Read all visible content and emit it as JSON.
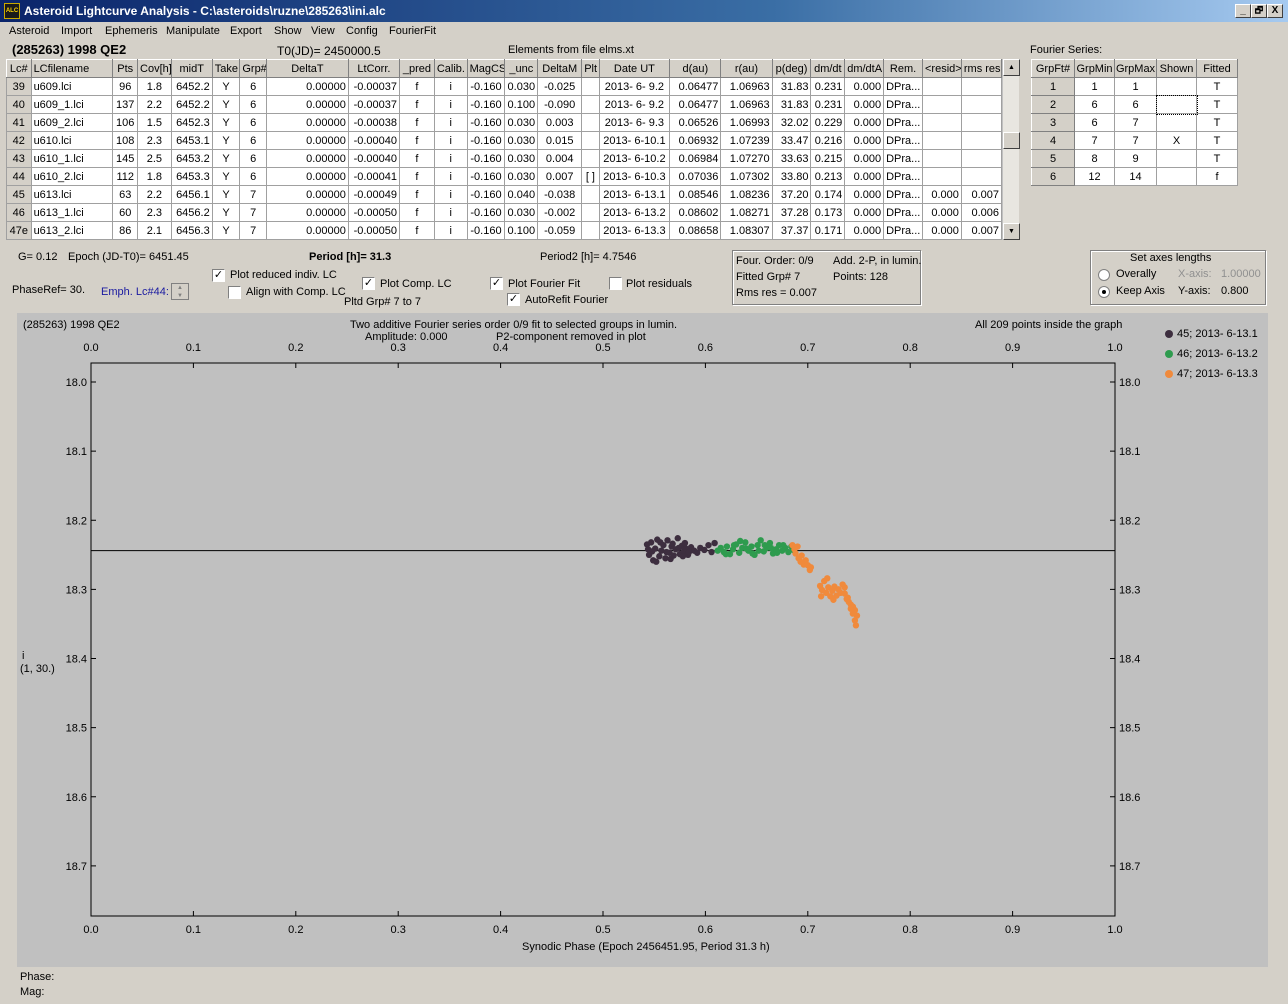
{
  "window": {
    "title": "Asteroid Lightcurve Analysis - C:\\asteroids\\ruzne\\285263\\ini.alc",
    "icon_label": "ALC",
    "controls": [
      "_",
      "🗗",
      "X"
    ]
  },
  "menu": [
    "Asteroid",
    "Import",
    "Ephemeris",
    "Manipulate",
    "Export",
    "Show",
    "View",
    "Config",
    "FourierFit"
  ],
  "header": {
    "asteroid": "(285263) 1998 QE2",
    "t0": "T0(JD)= 2450000.5",
    "elements": "Elements from file elms.xt"
  },
  "lc_table": {
    "columns": [
      "Lc#",
      "LCfilename",
      "Pts",
      "Cov[h]",
      "midT",
      "Take",
      "Grp#",
      "DeltaT",
      "LtCorr.",
      "_pred",
      "Calib.",
      "MagCS",
      "_unc",
      "DeltaM",
      "Plt",
      "Date UT",
      "d(au)",
      "r(au)",
      "p(deg)",
      "dm/dt",
      "dm/dtA",
      "Rem.",
      "<resid>",
      "rms res"
    ],
    "rows": [
      [
        "39",
        "u609.lci",
        "96",
        "1.8",
        "6452.2",
        "Y",
        "6",
        "0.00000",
        "-0.00037",
        "f",
        "i",
        "-0.160",
        "0.030",
        "-0.025",
        "",
        "2013- 6- 9.2",
        "0.06477",
        "1.06963",
        "31.83",
        "0.231",
        "0.000",
        "DPra...",
        "",
        ""
      ],
      [
        "40",
        "u609_1.lci",
        "137",
        "2.2",
        "6452.2",
        "Y",
        "6",
        "0.00000",
        "-0.00037",
        "f",
        "i",
        "-0.160",
        "0.100",
        "-0.090",
        "",
        "2013- 6- 9.2",
        "0.06477",
        "1.06963",
        "31.83",
        "0.231",
        "0.000",
        "DPra...",
        "",
        ""
      ],
      [
        "41",
        "u609_2.lci",
        "106",
        "1.5",
        "6452.3",
        "Y",
        "6",
        "0.00000",
        "-0.00038",
        "f",
        "i",
        "-0.160",
        "0.030",
        "0.003",
        "",
        "2013- 6- 9.3",
        "0.06526",
        "1.06993",
        "32.02",
        "0.229",
        "0.000",
        "DPra...",
        "",
        ""
      ],
      [
        "42",
        "u610.lci",
        "108",
        "2.3",
        "6453.1",
        "Y",
        "6",
        "0.00000",
        "-0.00040",
        "f",
        "i",
        "-0.160",
        "0.030",
        "0.015",
        "",
        "2013- 6-10.1",
        "0.06932",
        "1.07239",
        "33.47",
        "0.216",
        "0.000",
        "DPra...",
        "",
        ""
      ],
      [
        "43",
        "u610_1.lci",
        "145",
        "2.5",
        "6453.2",
        "Y",
        "6",
        "0.00000",
        "-0.00040",
        "f",
        "i",
        "-0.160",
        "0.030",
        "0.004",
        "",
        "2013- 6-10.2",
        "0.06984",
        "1.07270",
        "33.63",
        "0.215",
        "0.000",
        "DPra...",
        "",
        ""
      ],
      [
        "44",
        "u610_2.lci",
        "112",
        "1.8",
        "6453.3",
        "Y",
        "6",
        "0.00000",
        "-0.00041",
        "f",
        "i",
        "-0.160",
        "0.030",
        "0.007",
        "[ ]",
        "2013- 6-10.3",
        "0.07036",
        "1.07302",
        "33.80",
        "0.213",
        "0.000",
        "DPra...",
        "",
        ""
      ],
      [
        "45",
        "u613.lci",
        "63",
        "2.2",
        "6456.1",
        "Y",
        "7",
        "0.00000",
        "-0.00049",
        "f",
        "i",
        "-0.160",
        "0.040",
        "-0.038",
        "",
        "2013- 6-13.1",
        "0.08546",
        "1.08236",
        "37.20",
        "0.174",
        "0.000",
        "DPra...",
        "0.000",
        "0.007"
      ],
      [
        "46",
        "u613_1.lci",
        "60",
        "2.3",
        "6456.2",
        "Y",
        "7",
        "0.00000",
        "-0.00050",
        "f",
        "i",
        "-0.160",
        "0.030",
        "-0.002",
        "",
        "2013- 6-13.2",
        "0.08602",
        "1.08271",
        "37.28",
        "0.173",
        "0.000",
        "DPra...",
        "0.000",
        "0.006"
      ],
      [
        "47e",
        "u613_2.lci",
        "86",
        "2.1",
        "6456.3",
        "Y",
        "7",
        "0.00000",
        "-0.00050",
        "f",
        "i",
        "-0.160",
        "0.100",
        "-0.059",
        "",
        "2013- 6-13.3",
        "0.08658",
        "1.08307",
        "37.37",
        "0.171",
        "0.000",
        "DPra...",
        "0.000",
        "0.007"
      ]
    ]
  },
  "fourier_series": {
    "title": "Fourier Series:",
    "columns": [
      "GrpFt#",
      "GrpMin",
      "GrpMax",
      "Shown",
      "Fitted"
    ],
    "rows": [
      [
        "1",
        "1",
        "1",
        "",
        "T"
      ],
      [
        "2",
        "6",
        "6",
        "",
        "T"
      ],
      [
        "3",
        "6",
        "7",
        "",
        "T"
      ],
      [
        "4",
        "7",
        "7",
        "X",
        "T"
      ],
      [
        "5",
        "8",
        "9",
        "",
        "T"
      ],
      [
        "6",
        "12",
        "14",
        "",
        "f"
      ]
    ]
  },
  "controls": {
    "g": "G= 0.12",
    "epoch": "Epoch (JD-T0)= 6451.45",
    "period": "Period [h]= 31.3",
    "period2": "Period2 [h]= 4.7546",
    "phase_ref": "PhaseRef= 30.",
    "emph": "Emph. Lc#44:",
    "plot_reduced": "Plot reduced indiv. LC",
    "align": "Align with Comp. LC",
    "plot_comp": "Plot Comp. LC",
    "pltd_grp": "Pltd Grp#  7  to  7",
    "plot_fourier": "Plot Fourier Fit",
    "autorefit": "AutoRefit Fourier",
    "plot_residuals": "Plot residuals",
    "check_plot_reduced": "✓",
    "check_plot_comp": "✓",
    "check_plot_fourier": "✓",
    "check_autorefit": "✓"
  },
  "fit_info": {
    "order": "Four. Order:  0/9",
    "add": "Add. 2-P, in lumin.",
    "fitted": "Fitted Grp# 7",
    "points": "Points: 128",
    "rms": "Rms res     = 0.007"
  },
  "axes_box": {
    "title": "Set axes lengths",
    "overally": "Overally",
    "keep_axis": "Keep Axis",
    "x_label": "X-axis:",
    "x_value": "1.00000",
    "y_label": "Y-axis:",
    "y_value": "0.800"
  },
  "plot": {
    "title_left": "(285263) 1998 QE2",
    "title_center1": "Two additive Fourier series order 0/9 fit to selected groups in lumin.",
    "title_center2a": "Amplitude: 0.000",
    "title_center2b": "P2-component removed in plot",
    "title_right": "All 209 points inside the graph",
    "ylabel1": "i",
    "ylabel2": "(1, 30.)",
    "xlabel": "Synodic Phase (Epoch 2456451.95, Period 31.3 h)",
    "legend": [
      {
        "label": "45; 2013- 6-13.1",
        "color": "#3d2e3f"
      },
      {
        "label": "46; 2013- 6-13.2",
        "color": "#2e9b4e"
      },
      {
        "label": "47; 2013- 6-13.3",
        "color": "#f08a3c"
      }
    ]
  },
  "chart_data": {
    "type": "scatter",
    "xlim": [
      0.0,
      1.0
    ],
    "ylim": [
      18.7725,
      17.9725
    ],
    "x_ticks": [
      "0.0",
      "0.1",
      "0.2",
      "0.3",
      "0.4",
      "0.5",
      "0.6",
      "0.7",
      "0.8",
      "0.9",
      "1.0"
    ],
    "y_ticks": [
      "18.0",
      "18.1",
      "18.2",
      "18.3",
      "18.4",
      "18.5",
      "18.6",
      "18.7"
    ],
    "fit_line": 18.244,
    "series": [
      {
        "name": "45; 2013- 6-13.1",
        "color": "#3d2e3f",
        "points": [
          [
            0.543,
            18.235
          ],
          [
            0.545,
            18.25
          ],
          [
            0.547,
            18.232
          ],
          [
            0.549,
            18.258
          ],
          [
            0.551,
            18.241
          ],
          [
            0.553,
            18.228
          ],
          [
            0.555,
            18.252
          ],
          [
            0.557,
            18.244
          ],
          [
            0.559,
            18.236
          ],
          [
            0.561,
            18.255
          ],
          [
            0.563,
            18.229
          ],
          [
            0.565,
            18.247
          ],
          [
            0.567,
            18.238
          ],
          [
            0.569,
            18.251
          ],
          [
            0.571,
            18.242
          ],
          [
            0.573,
            18.226
          ],
          [
            0.575,
            18.249
          ],
          [
            0.577,
            18.237
          ],
          [
            0.579,
            18.245
          ],
          [
            0.581,
            18.241
          ],
          [
            0.583,
            18.25
          ],
          [
            0.586,
            18.239
          ],
          [
            0.589,
            18.244
          ],
          [
            0.592,
            18.247
          ],
          [
            0.595,
            18.24
          ],
          [
            0.599,
            18.243
          ],
          [
            0.603,
            18.236
          ],
          [
            0.606,
            18.246
          ],
          [
            0.609,
            18.233
          ],
          [
            0.548,
            18.245
          ],
          [
            0.556,
            18.232
          ],
          [
            0.562,
            18.246
          ],
          [
            0.568,
            18.234
          ],
          [
            0.574,
            18.24
          ],
          [
            0.58,
            18.233
          ],
          [
            0.584,
            18.246
          ],
          [
            0.552,
            18.26
          ],
          [
            0.566,
            18.256
          ],
          [
            0.578,
            18.252
          ],
          [
            0.544,
            18.242
          ]
        ]
      },
      {
        "name": "46; 2013- 6-13.2",
        "color": "#2e9b4e",
        "points": [
          [
            0.612,
            18.244
          ],
          [
            0.615,
            18.24
          ],
          [
            0.618,
            18.246
          ],
          [
            0.621,
            18.238
          ],
          [
            0.624,
            18.249
          ],
          [
            0.627,
            18.242
          ],
          [
            0.63,
            18.235
          ],
          [
            0.633,
            18.247
          ],
          [
            0.636,
            18.24
          ],
          [
            0.639,
            18.232
          ],
          [
            0.642,
            18.244
          ],
          [
            0.645,
            18.238
          ],
          [
            0.648,
            18.25
          ],
          [
            0.651,
            18.236
          ],
          [
            0.654,
            18.229
          ],
          [
            0.657,
            18.245
          ],
          [
            0.66,
            18.24
          ],
          [
            0.663,
            18.233
          ],
          [
            0.666,
            18.248
          ],
          [
            0.669,
            18.242
          ],
          [
            0.672,
            18.236
          ],
          [
            0.675,
            18.244
          ],
          [
            0.678,
            18.24
          ],
          [
            0.681,
            18.246
          ],
          [
            0.684,
            18.238
          ],
          [
            0.62,
            18.249
          ],
          [
            0.634,
            18.23
          ],
          [
            0.646,
            18.248
          ],
          [
            0.658,
            18.236
          ],
          [
            0.67,
            18.247
          ],
          [
            0.64,
            18.241
          ],
          [
            0.652,
            18.244
          ],
          [
            0.664,
            18.24
          ],
          [
            0.676,
            18.236
          ],
          [
            0.628,
            18.236
          ],
          [
            0.686,
            18.243
          ]
        ]
      },
      {
        "name": "47; 2013- 6-13.3",
        "color": "#f08a3c",
        "points": [
          [
            0.685,
            18.236
          ],
          [
            0.687,
            18.242
          ],
          [
            0.688,
            18.248
          ],
          [
            0.69,
            18.238
          ],
          [
            0.691,
            18.255
          ],
          [
            0.693,
            18.26
          ],
          [
            0.694,
            18.251
          ],
          [
            0.696,
            18.264
          ],
          [
            0.698,
            18.258
          ],
          [
            0.7,
            18.265
          ],
          [
            0.702,
            18.272
          ],
          [
            0.703,
            18.268
          ],
          [
            0.712,
            18.295
          ],
          [
            0.714,
            18.301
          ],
          [
            0.716,
            18.288
          ],
          [
            0.718,
            18.305
          ],
          [
            0.72,
            18.297
          ],
          [
            0.722,
            18.31
          ],
          [
            0.724,
            18.302
          ],
          [
            0.726,
            18.296
          ],
          [
            0.728,
            18.309
          ],
          [
            0.73,
            18.3
          ],
          [
            0.732,
            18.305
          ],
          [
            0.734,
            18.293
          ],
          [
            0.736,
            18.306
          ],
          [
            0.738,
            18.314
          ],
          [
            0.74,
            18.318
          ],
          [
            0.742,
            18.322
          ],
          [
            0.744,
            18.325
          ],
          [
            0.746,
            18.33
          ],
          [
            0.748,
            18.338
          ],
          [
            0.746,
            18.345
          ],
          [
            0.747,
            18.352
          ],
          [
            0.744,
            18.335
          ],
          [
            0.742,
            18.328
          ],
          [
            0.739,
            18.312
          ],
          [
            0.725,
            18.315
          ],
          [
            0.719,
            18.284
          ],
          [
            0.713,
            18.31
          ],
          [
            0.736,
            18.297
          ]
        ]
      }
    ]
  },
  "status": {
    "phase": "Phase:",
    "mag": "Mag:"
  }
}
